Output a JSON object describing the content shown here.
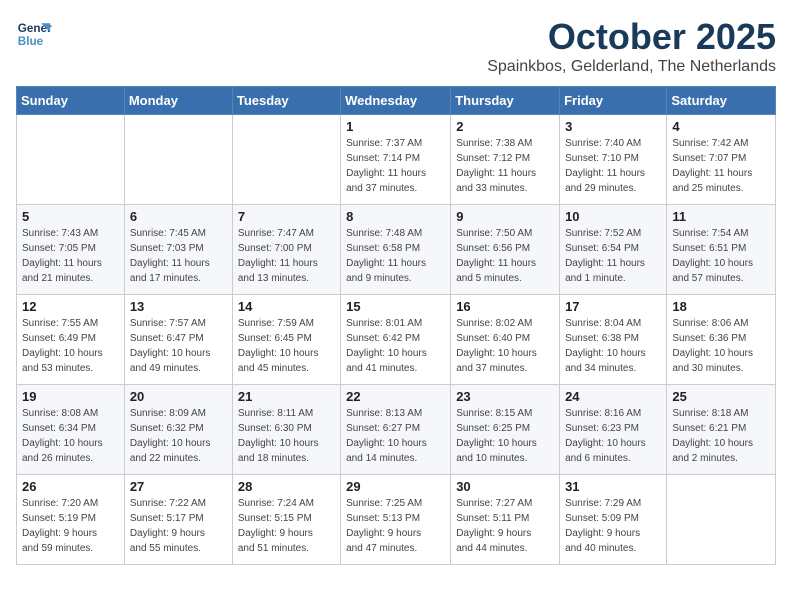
{
  "logo": {
    "line1": "General",
    "line2": "Blue"
  },
  "title": "October 2025",
  "subtitle": "Spainkbos, Gelderland, The Netherlands",
  "headers": [
    "Sunday",
    "Monday",
    "Tuesday",
    "Wednesday",
    "Thursday",
    "Friday",
    "Saturday"
  ],
  "weeks": [
    [
      {
        "day": "",
        "info": ""
      },
      {
        "day": "",
        "info": ""
      },
      {
        "day": "",
        "info": ""
      },
      {
        "day": "1",
        "info": "Sunrise: 7:37 AM\nSunset: 7:14 PM\nDaylight: 11 hours\nand 37 minutes."
      },
      {
        "day": "2",
        "info": "Sunrise: 7:38 AM\nSunset: 7:12 PM\nDaylight: 11 hours\nand 33 minutes."
      },
      {
        "day": "3",
        "info": "Sunrise: 7:40 AM\nSunset: 7:10 PM\nDaylight: 11 hours\nand 29 minutes."
      },
      {
        "day": "4",
        "info": "Sunrise: 7:42 AM\nSunset: 7:07 PM\nDaylight: 11 hours\nand 25 minutes."
      }
    ],
    [
      {
        "day": "5",
        "info": "Sunrise: 7:43 AM\nSunset: 7:05 PM\nDaylight: 11 hours\nand 21 minutes."
      },
      {
        "day": "6",
        "info": "Sunrise: 7:45 AM\nSunset: 7:03 PM\nDaylight: 11 hours\nand 17 minutes."
      },
      {
        "day": "7",
        "info": "Sunrise: 7:47 AM\nSunset: 7:00 PM\nDaylight: 11 hours\nand 13 minutes."
      },
      {
        "day": "8",
        "info": "Sunrise: 7:48 AM\nSunset: 6:58 PM\nDaylight: 11 hours\nand 9 minutes."
      },
      {
        "day": "9",
        "info": "Sunrise: 7:50 AM\nSunset: 6:56 PM\nDaylight: 11 hours\nand 5 minutes."
      },
      {
        "day": "10",
        "info": "Sunrise: 7:52 AM\nSunset: 6:54 PM\nDaylight: 11 hours\nand 1 minute."
      },
      {
        "day": "11",
        "info": "Sunrise: 7:54 AM\nSunset: 6:51 PM\nDaylight: 10 hours\nand 57 minutes."
      }
    ],
    [
      {
        "day": "12",
        "info": "Sunrise: 7:55 AM\nSunset: 6:49 PM\nDaylight: 10 hours\nand 53 minutes."
      },
      {
        "day": "13",
        "info": "Sunrise: 7:57 AM\nSunset: 6:47 PM\nDaylight: 10 hours\nand 49 minutes."
      },
      {
        "day": "14",
        "info": "Sunrise: 7:59 AM\nSunset: 6:45 PM\nDaylight: 10 hours\nand 45 minutes."
      },
      {
        "day": "15",
        "info": "Sunrise: 8:01 AM\nSunset: 6:42 PM\nDaylight: 10 hours\nand 41 minutes."
      },
      {
        "day": "16",
        "info": "Sunrise: 8:02 AM\nSunset: 6:40 PM\nDaylight: 10 hours\nand 37 minutes."
      },
      {
        "day": "17",
        "info": "Sunrise: 8:04 AM\nSunset: 6:38 PM\nDaylight: 10 hours\nand 34 minutes."
      },
      {
        "day": "18",
        "info": "Sunrise: 8:06 AM\nSunset: 6:36 PM\nDaylight: 10 hours\nand 30 minutes."
      }
    ],
    [
      {
        "day": "19",
        "info": "Sunrise: 8:08 AM\nSunset: 6:34 PM\nDaylight: 10 hours\nand 26 minutes."
      },
      {
        "day": "20",
        "info": "Sunrise: 8:09 AM\nSunset: 6:32 PM\nDaylight: 10 hours\nand 22 minutes."
      },
      {
        "day": "21",
        "info": "Sunrise: 8:11 AM\nSunset: 6:30 PM\nDaylight: 10 hours\nand 18 minutes."
      },
      {
        "day": "22",
        "info": "Sunrise: 8:13 AM\nSunset: 6:27 PM\nDaylight: 10 hours\nand 14 minutes."
      },
      {
        "day": "23",
        "info": "Sunrise: 8:15 AM\nSunset: 6:25 PM\nDaylight: 10 hours\nand 10 minutes."
      },
      {
        "day": "24",
        "info": "Sunrise: 8:16 AM\nSunset: 6:23 PM\nDaylight: 10 hours\nand 6 minutes."
      },
      {
        "day": "25",
        "info": "Sunrise: 8:18 AM\nSunset: 6:21 PM\nDaylight: 10 hours\nand 2 minutes."
      }
    ],
    [
      {
        "day": "26",
        "info": "Sunrise: 7:20 AM\nSunset: 5:19 PM\nDaylight: 9 hours\nand 59 minutes."
      },
      {
        "day": "27",
        "info": "Sunrise: 7:22 AM\nSunset: 5:17 PM\nDaylight: 9 hours\nand 55 minutes."
      },
      {
        "day": "28",
        "info": "Sunrise: 7:24 AM\nSunset: 5:15 PM\nDaylight: 9 hours\nand 51 minutes."
      },
      {
        "day": "29",
        "info": "Sunrise: 7:25 AM\nSunset: 5:13 PM\nDaylight: 9 hours\nand 47 minutes."
      },
      {
        "day": "30",
        "info": "Sunrise: 7:27 AM\nSunset: 5:11 PM\nDaylight: 9 hours\nand 44 minutes."
      },
      {
        "day": "31",
        "info": "Sunrise: 7:29 AM\nSunset: 5:09 PM\nDaylight: 9 hours\nand 40 minutes."
      },
      {
        "day": "",
        "info": ""
      }
    ]
  ]
}
